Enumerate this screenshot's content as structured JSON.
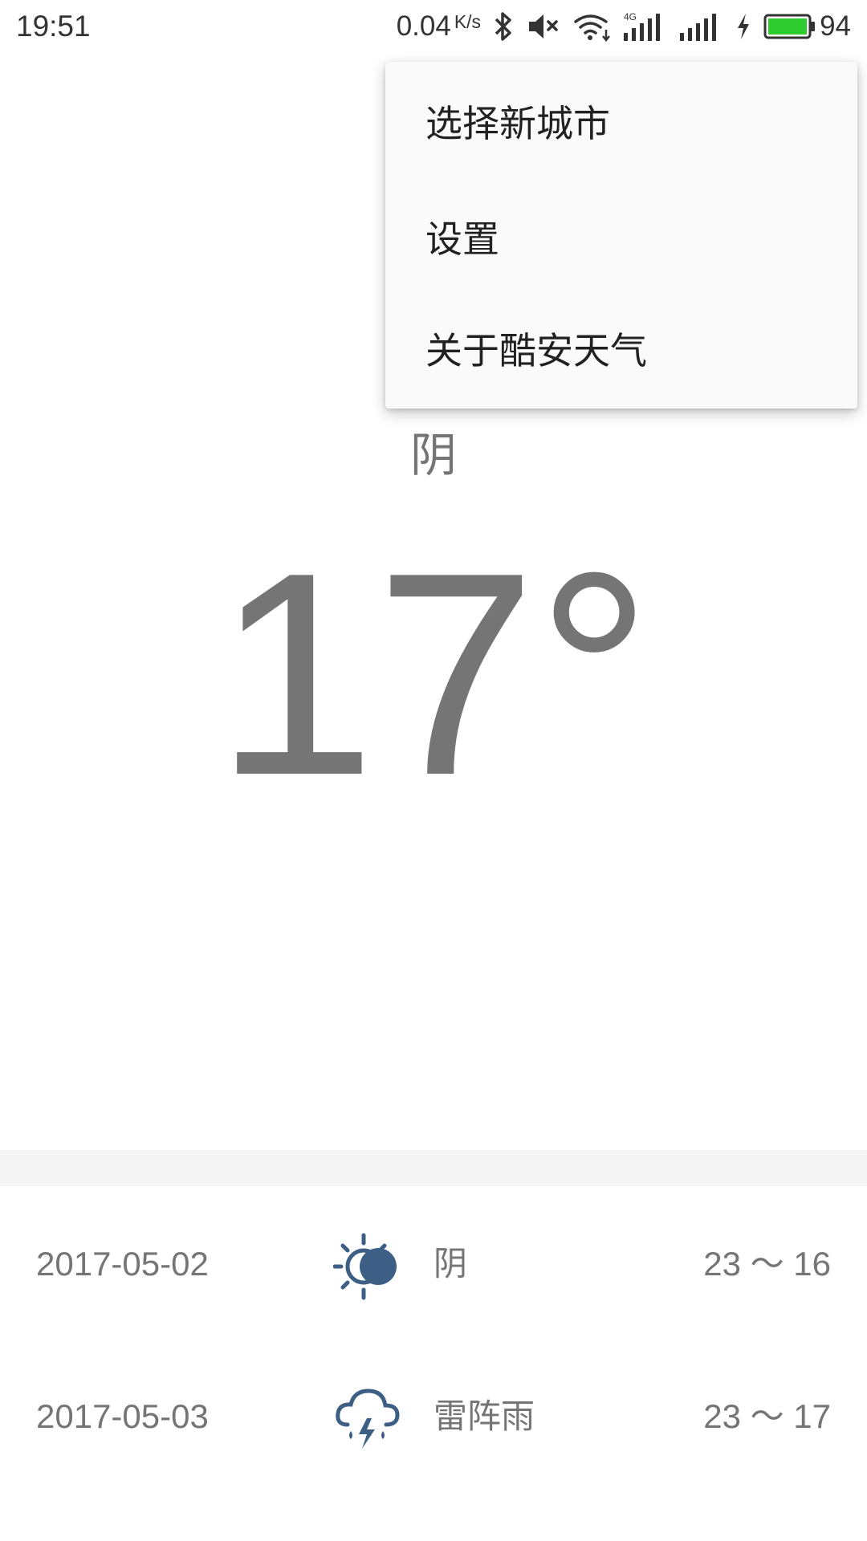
{
  "status_bar": {
    "time": "19:51",
    "network_speed": "0.04",
    "speed_unit": "K/s",
    "battery_level": "94",
    "icons": [
      "bluetooth-icon",
      "mute-icon",
      "wifi-icon",
      "4g-signal-icon",
      "signal-icon",
      "charging-icon",
      "battery-icon"
    ],
    "battery_color": "#2ecc2e"
  },
  "current": {
    "condition": "阴",
    "temperature": "17°"
  },
  "menu": {
    "items": [
      {
        "label": "选择新城市"
      },
      {
        "label": "设置"
      },
      {
        "label": "关于酷安天气"
      }
    ]
  },
  "forecast": [
    {
      "date": "2017-05-02",
      "icon": "cloudy-sun-icon",
      "condition": "阴",
      "range": "23 ～ 16"
    },
    {
      "date": "2017-05-03",
      "icon": "thunderstorm-icon",
      "condition": "雷阵雨",
      "range": "23 ～ 17"
    }
  ],
  "colors": {
    "icon_blue": "#3d5f85",
    "text_gray": "#757575",
    "band": "#f5f5f5",
    "menu_bg": "#fafafa"
  }
}
